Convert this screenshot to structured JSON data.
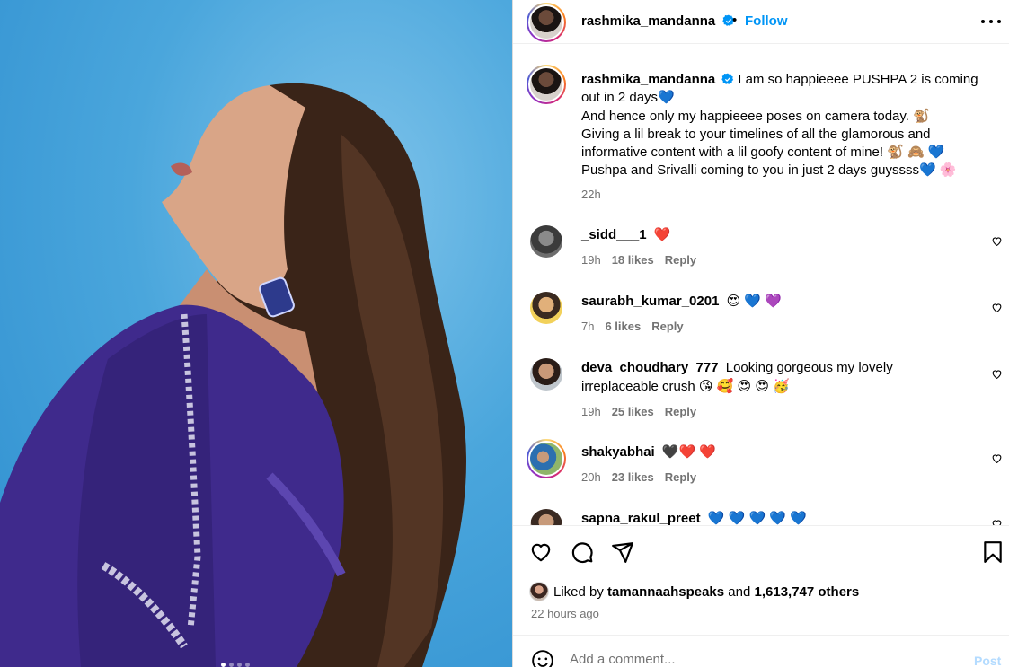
{
  "post": {
    "author": "rashmika_mandanna",
    "follow_label": "Follow",
    "dot": "•",
    "caption_line1": "I am so happieeee PUSHPA 2 is coming out in 2 days💙",
    "caption_line2": "And hence only my happieeee poses on camera today. 🐒",
    "caption_line3": "Giving a lil break to your timelines of all the glamorous and informative content with a lil goofy content of mine! 🐒 🙈 💙",
    "caption_line4": "Pushpa and Srivalli coming to you in just 2 days guyssss💙 🌸",
    "caption_time": "22h"
  },
  "comments": [
    {
      "user": "_sidd___1",
      "text": "❤️",
      "time": "19h",
      "likes": "18 likes",
      "reply": "Reply"
    },
    {
      "user": "saurabh_kumar_0201",
      "text": "😍 💙 💜",
      "time": "7h",
      "likes": "6 likes",
      "reply": "Reply"
    },
    {
      "user": "deva_choudhary_777",
      "text": "Looking gorgeous my lovely irreplaceable crush 😘 🥰 😍 😍 🥳",
      "time": "19h",
      "likes": "25 likes",
      "reply": "Reply"
    },
    {
      "user": "shakyabhai",
      "text": "🖤❤️ ❤️",
      "time": "20h",
      "likes": "23 likes",
      "reply": "Reply"
    },
    {
      "user": "sapna_rakul_preet",
      "text": "💙 💙 💙 💙 💙",
      "time": "",
      "likes": "",
      "reply": ""
    }
  ],
  "likes": {
    "prefix": "Liked by",
    "user": "tamannaahspeaks",
    "and": "and",
    "others": "1,613,747 others",
    "time": "22 hours ago"
  },
  "compose": {
    "placeholder": "Add a comment...",
    "post_label": "Post"
  },
  "colors": {
    "accent": "#0095f6",
    "verified": "#0095f6",
    "muted": "#737373",
    "post_disabled": "#b3dbff",
    "photo_bg": "#4aa6dc",
    "dress": "#3f2a8c"
  }
}
